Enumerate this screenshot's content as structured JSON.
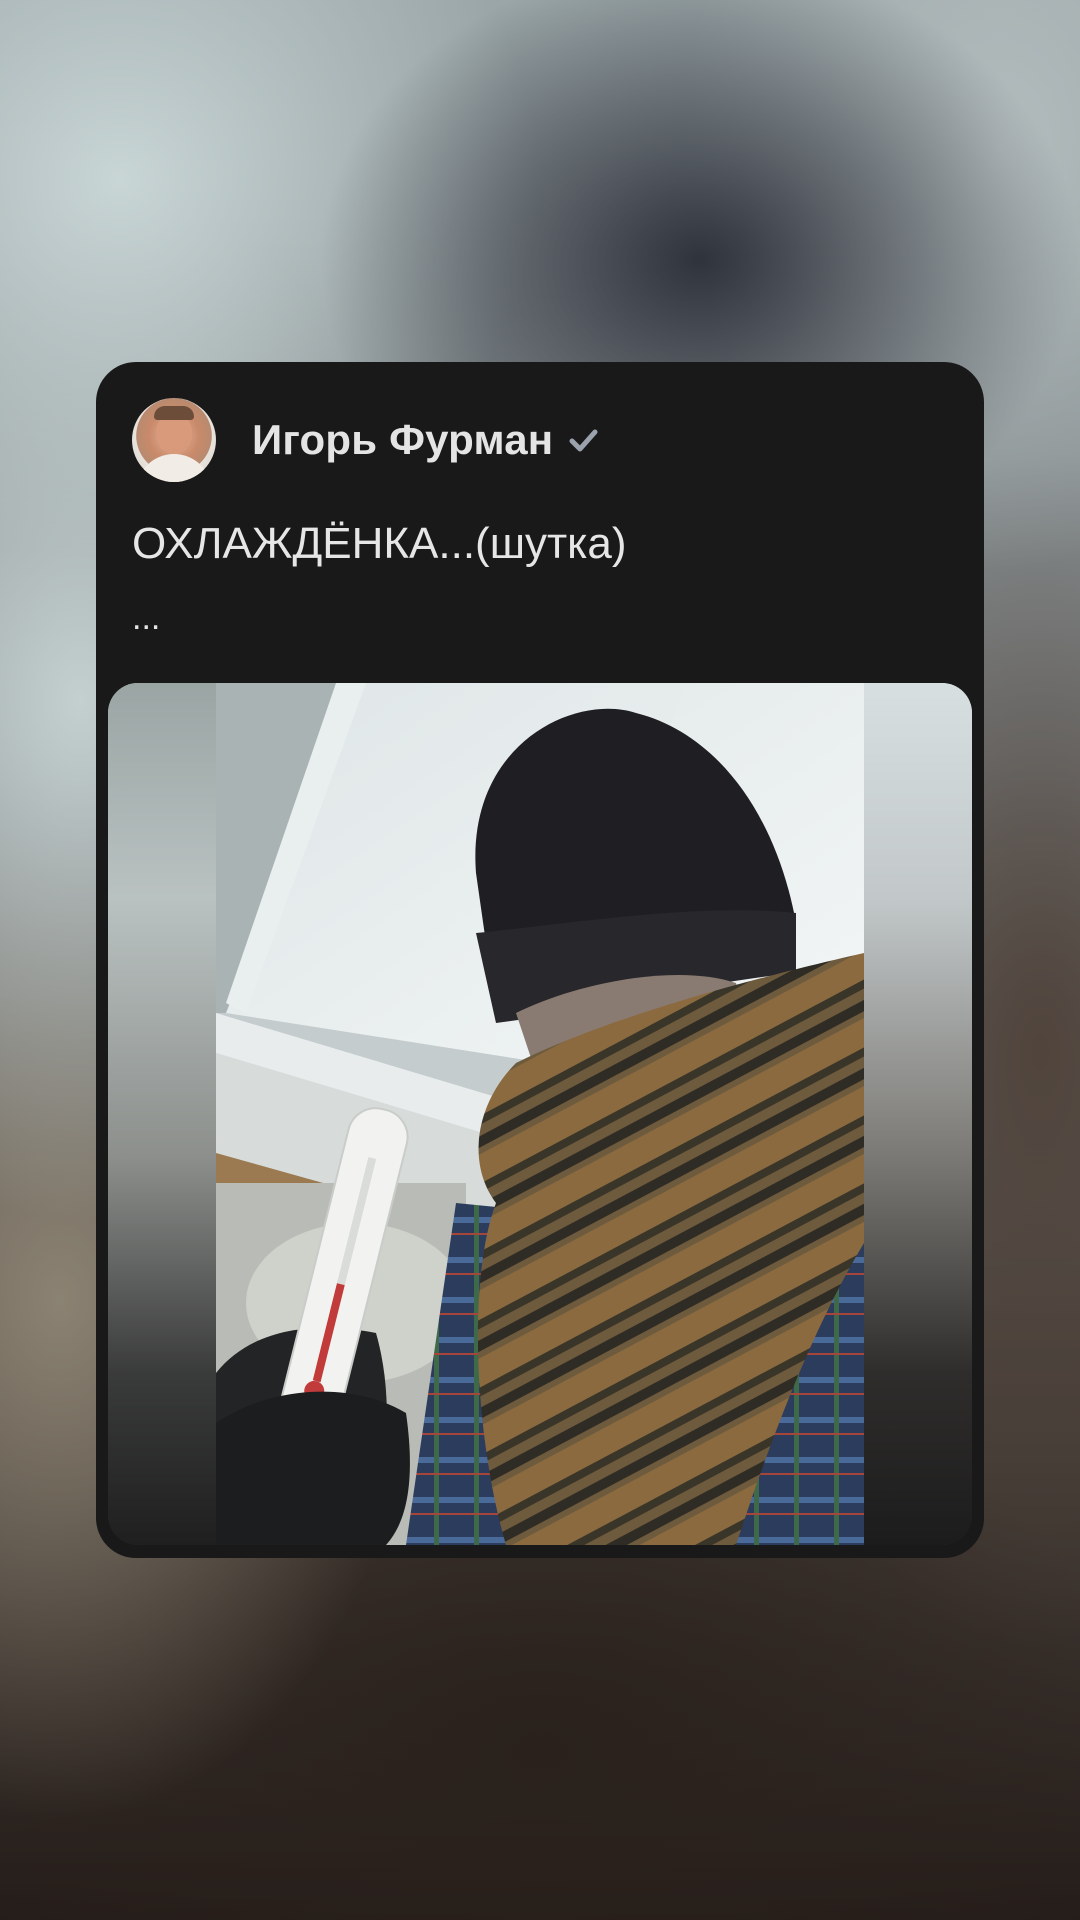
{
  "post": {
    "author": "Игорь Фурман",
    "text": "ОХЛАЖДЁНКА...(шутка)",
    "ellipsis": "..."
  },
  "colors": {
    "card_background": "#191919",
    "text": "#e6e6e6",
    "verified": "#9aa3ad"
  },
  "icons": {
    "verified": "verified-check-icon"
  }
}
